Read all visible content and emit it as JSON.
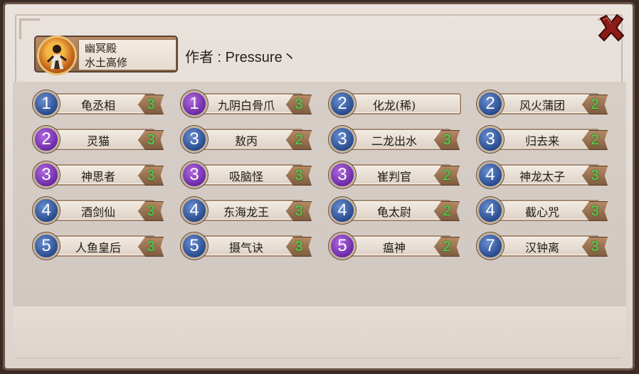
{
  "header": {
    "hero_name": "幽冥殿",
    "hero_subtitle": "水土高修",
    "author_label": "作者 : Pressure丶"
  },
  "colors": {
    "blue_cost": "#284b8e",
    "purple_cost": "#6a2aa6",
    "count_text": "#4ee04e"
  },
  "cards": [
    {
      "cost": "1",
      "color": "blue",
      "name": "龟丞相",
      "count": "3"
    },
    {
      "cost": "1",
      "color": "purple",
      "name": "九阴白骨爪",
      "count": "3"
    },
    {
      "cost": "2",
      "color": "blue",
      "name": "化龙(稀)",
      "count": ""
    },
    {
      "cost": "2",
      "color": "blue",
      "name": "风火蒲团",
      "count": "2"
    },
    {
      "cost": "2",
      "color": "purple",
      "name": "灵猫",
      "count": "3"
    },
    {
      "cost": "3",
      "color": "blue",
      "name": "敖丙",
      "count": "2"
    },
    {
      "cost": "3",
      "color": "blue",
      "name": "二龙出水",
      "count": "3"
    },
    {
      "cost": "3",
      "color": "blue",
      "name": "归去来",
      "count": "2"
    },
    {
      "cost": "3",
      "color": "purple",
      "name": "神思者",
      "count": "3"
    },
    {
      "cost": "3",
      "color": "purple",
      "name": "吸脑怪",
      "count": "3"
    },
    {
      "cost": "3",
      "color": "purple",
      "name": "崔判官",
      "count": "2"
    },
    {
      "cost": "4",
      "color": "blue",
      "name": "神龙太子",
      "count": "3"
    },
    {
      "cost": "4",
      "color": "blue",
      "name": "酒剑仙",
      "count": "3"
    },
    {
      "cost": "4",
      "color": "blue",
      "name": "东海龙王",
      "count": "3"
    },
    {
      "cost": "4",
      "color": "blue",
      "name": "龟太尉",
      "count": "2"
    },
    {
      "cost": "4",
      "color": "blue",
      "name": "截心咒",
      "count": "3"
    },
    {
      "cost": "5",
      "color": "blue",
      "name": "人鱼皇后",
      "count": "3"
    },
    {
      "cost": "5",
      "color": "blue",
      "name": "摄气诀",
      "count": "3"
    },
    {
      "cost": "5",
      "color": "purple",
      "name": "瘟神",
      "count": "2"
    },
    {
      "cost": "7",
      "color": "blue",
      "name": "汉钟离",
      "count": "3"
    }
  ],
  "icons": {
    "close": "close-icon",
    "portrait": "hero-portrait-icon"
  }
}
